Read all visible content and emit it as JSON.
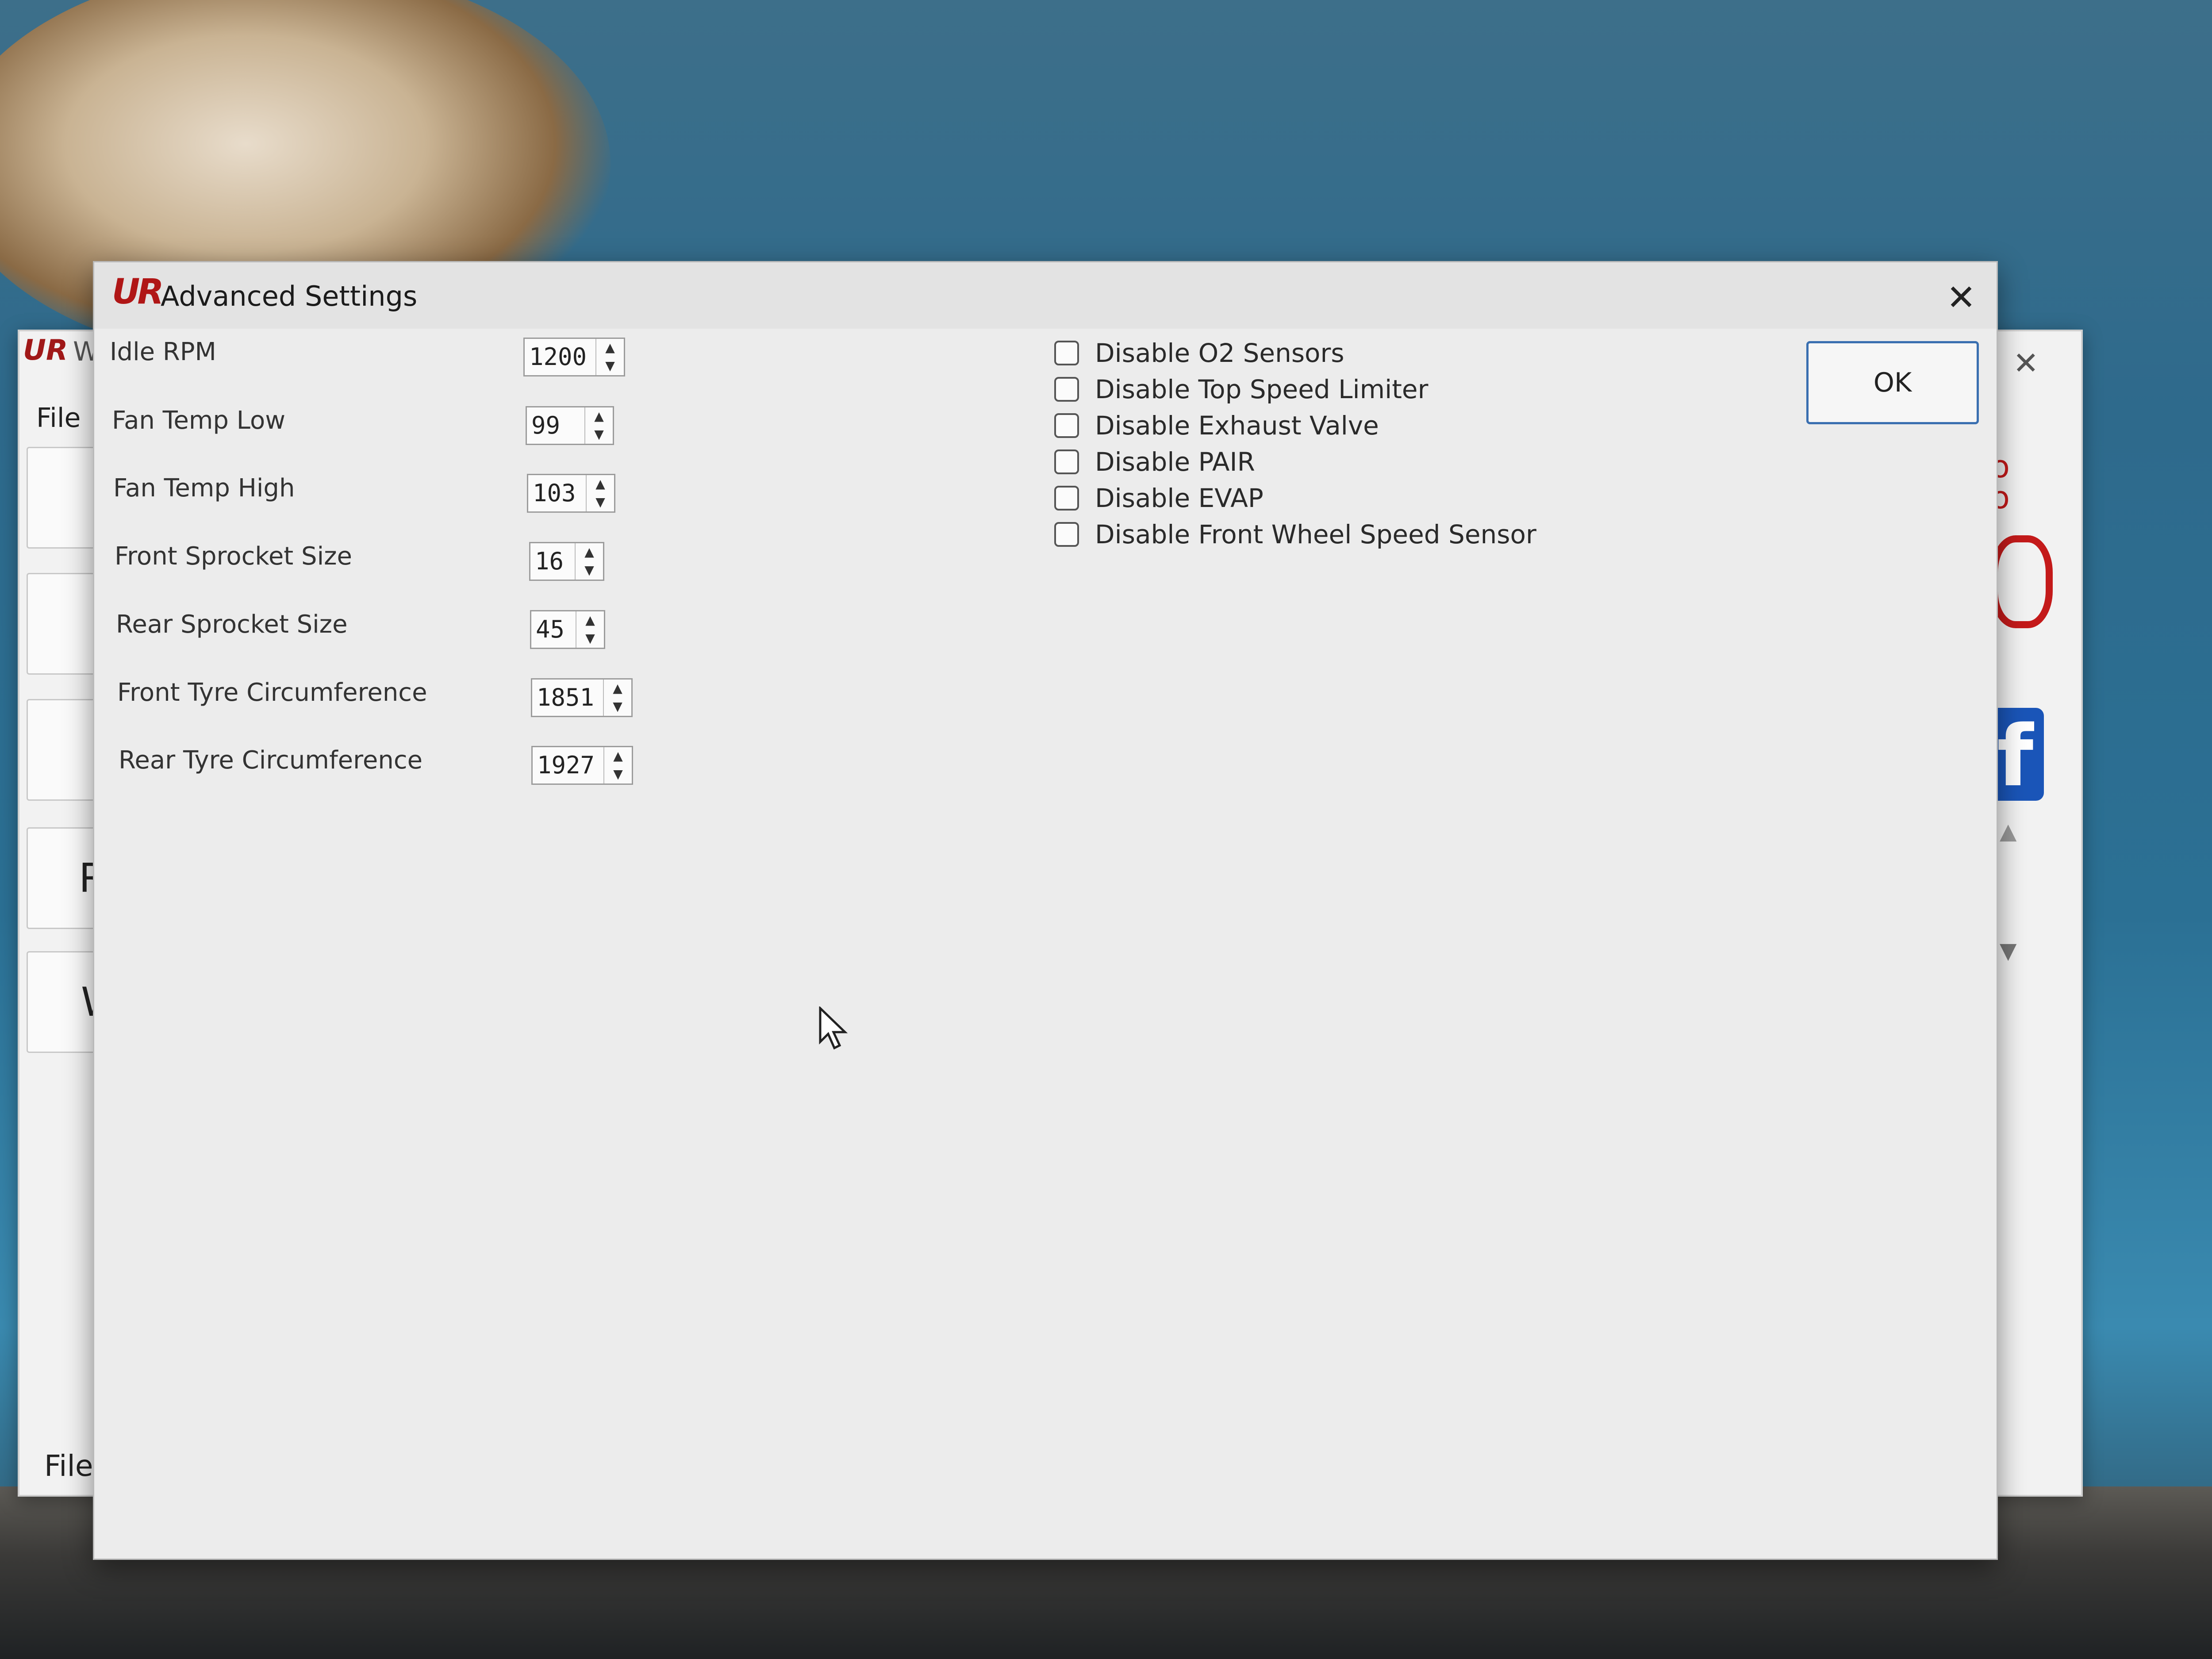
{
  "back_window": {
    "title_fragment": "W",
    "menu_file": "File",
    "button_r": "R",
    "button_w": "W",
    "status_fragment": "File S"
  },
  "dialog": {
    "title": "Advanced Settings",
    "close_glyph": "✕",
    "ok_label": "OK",
    "fields": [
      {
        "label": "Idle RPM",
        "value": "1200"
      },
      {
        "label": "Fan Temp Low",
        "value": "99"
      },
      {
        "label": "Fan Temp High",
        "value": "103"
      },
      {
        "label": "Front Sprocket Size",
        "value": "16"
      },
      {
        "label": "Rear Sprocket Size",
        "value": "45"
      },
      {
        "label": "Front Tyre Circumference",
        "value": "1851"
      },
      {
        "label": "Rear Tyre Circumference",
        "value": "1927"
      }
    ],
    "checkboxes": [
      {
        "label": "Disable O2 Sensors",
        "checked": false
      },
      {
        "label": "Disable Top Speed Limiter",
        "checked": false
      },
      {
        "label": "Disable Exhaust Valve",
        "checked": false
      },
      {
        "label": "Disable PAIR",
        "checked": false
      },
      {
        "label": "Disable EVAP",
        "checked": false
      },
      {
        "label": "Disable Front Wheel Speed Sensor",
        "checked": false
      }
    ]
  },
  "icons": {
    "app_icon": "app-logo-icon",
    "spin_up": "▲",
    "spin_down": "▼",
    "facebook": "f"
  }
}
